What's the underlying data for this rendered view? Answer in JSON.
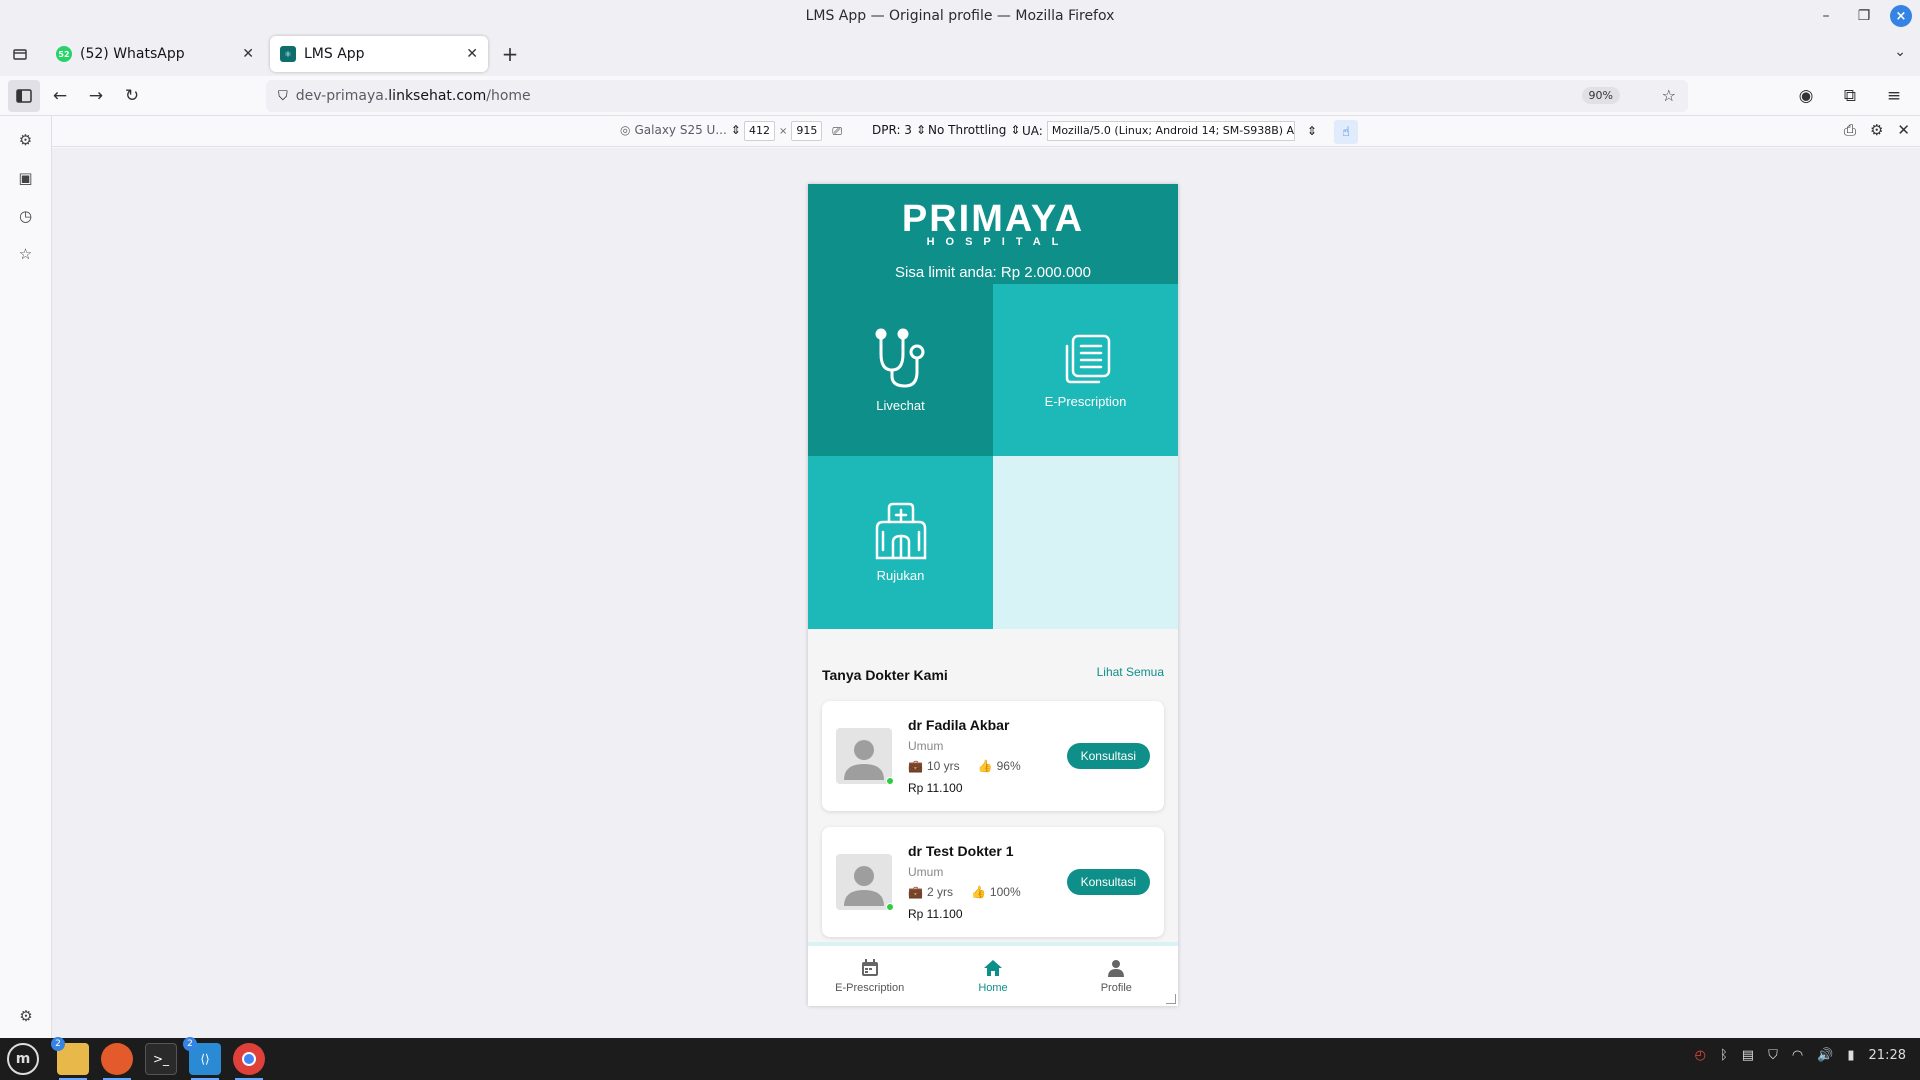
{
  "window": {
    "title": "LMS App — Original profile — Mozilla Firefox"
  },
  "tabs": [
    {
      "label": "(52) WhatsApp",
      "badge": "52",
      "active": false
    },
    {
      "label": "LMS App",
      "active": true
    }
  ],
  "nav": {
    "url_host_prefix": "dev-primaya.",
    "url_host": "linksehat.com",
    "url_path": "/home",
    "zoom": "90%"
  },
  "rdm": {
    "device": "Galaxy S25 U...",
    "width": "412",
    "height": "915",
    "times": "×",
    "dpr": "DPR: 3",
    "throttling": "No Throttling",
    "ua_label": "UA:",
    "ua_value": "Mozilla/5.0 (Linux; Android 14; SM-S938B) Ap"
  },
  "app": {
    "brand": "PRIMAYA",
    "brand_sub": "HOSPITAL",
    "limit_text": "Sisa limit anda: Rp 2.000.000",
    "tiles": [
      {
        "label": "Livechat",
        "icon": "stethoscope-icon"
      },
      {
        "label": "E-Prescription",
        "icon": "document-icon"
      },
      {
        "label": "Rujukan",
        "icon": "hospital-icon"
      }
    ],
    "section_title": "Tanya Dokter Kami",
    "see_all": "Lihat Semua",
    "doctors": [
      {
        "name": "dr Fadila Akbar",
        "specialty": "Umum",
        "experience": "10 yrs",
        "rating": "96%",
        "price": "Rp 11.100",
        "button": "Konsultasi"
      },
      {
        "name": "dr Test Dokter 1",
        "specialty": "Umum",
        "experience": "2 yrs",
        "rating": "100%",
        "price": "Rp 11.100",
        "button": "Konsultasi"
      }
    ],
    "bottom_nav": [
      {
        "label": "E-Prescription",
        "icon": "calendar-icon",
        "active": false
      },
      {
        "label": "Home",
        "icon": "home-icon",
        "active": true
      },
      {
        "label": "Profile",
        "icon": "user-icon",
        "active": false
      }
    ],
    "colors": {
      "primary": "#0e8f8a",
      "secondary": "#1db8b8",
      "light": "#d8f3f6"
    }
  },
  "taskbar": {
    "clock": "21:28",
    "files_badge": "2",
    "vscode_badge": "2"
  }
}
